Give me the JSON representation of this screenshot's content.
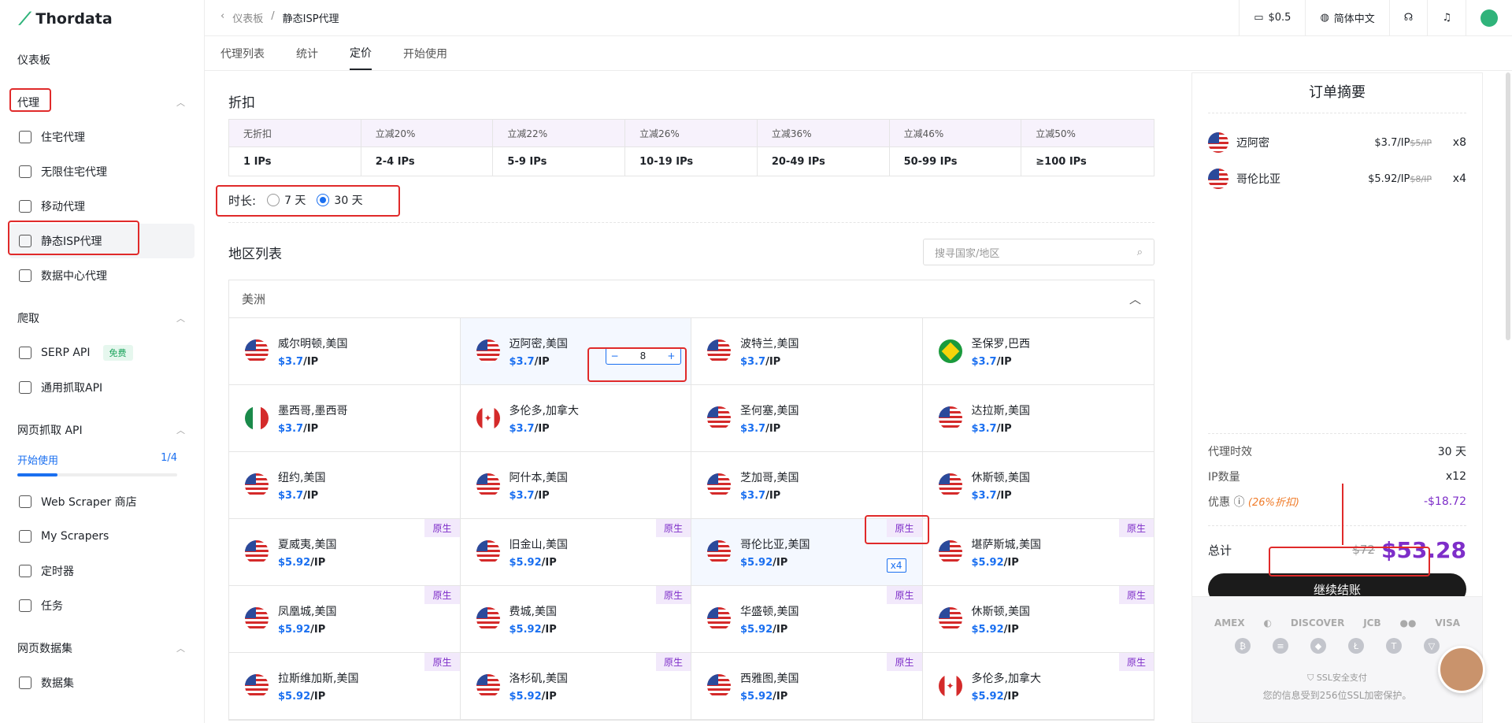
{
  "brand": {
    "name": "Thordata"
  },
  "sidebar": {
    "dashboard": "仪表板",
    "sections": [
      {
        "title": "代理",
        "items": [
          "住宅代理",
          "无限住宅代理",
          "移动代理",
          "静态ISP代理",
          "数据中心代理"
        ]
      },
      {
        "title": "爬取",
        "items": [
          "SERP API",
          "通用抓取API"
        ],
        "free_tag": "免费"
      },
      {
        "title": "网页抓取 API",
        "start": "开始使用",
        "progress_text": "1/4",
        "progress": 0.25,
        "items": [
          "Web Scraper 商店",
          "My Scrapers",
          "定时器",
          "任务"
        ]
      },
      {
        "title": "网页数据集",
        "items": [
          "数据集"
        ]
      }
    ]
  },
  "topbar": {
    "breadcrumb": [
      "仪表板",
      "静态ISP代理"
    ],
    "balance": "$0.5",
    "language": "简体中文"
  },
  "tabs": [
    "代理列表",
    "统计",
    "定价",
    "开始使用"
  ],
  "discount": {
    "title": "折扣",
    "headers": [
      "无折扣",
      "立减20%",
      "立减22%",
      "立减26%",
      "立减36%",
      "立减46%",
      "立减50%"
    ],
    "values": [
      "1 IPs",
      "2-4 IPs",
      "5-9 IPs",
      "10-19 IPs",
      "20-49 IPs",
      "50-99 IPs",
      "≥100 IPs"
    ]
  },
  "duration": {
    "label": "时长:",
    "opt1": "7 天",
    "opt2": "30 天"
  },
  "regions": {
    "title": "地区列表",
    "search_placeholder": "搜寻国家/地区",
    "continent": "美洲",
    "native": "原生",
    "stepper_value": "8",
    "badge": "x4",
    "unit": "/IP",
    "cities": [
      {
        "name": "威尔明顿,美国",
        "price": "$3.7"
      },
      {
        "name": "迈阿密,美国",
        "price": "$3.7"
      },
      {
        "name": "波特兰,美国",
        "price": "$3.7"
      },
      {
        "name": "圣保罗,巴西",
        "price": "$3.7"
      },
      {
        "name": "墨西哥,墨西哥",
        "price": "$3.7"
      },
      {
        "name": "多伦多,加拿大",
        "price": "$3.7"
      },
      {
        "name": "圣何塞,美国",
        "price": "$3.7"
      },
      {
        "name": "达拉斯,美国",
        "price": "$3.7"
      },
      {
        "name": "纽约,美国",
        "price": "$3.7"
      },
      {
        "name": "阿什本,美国",
        "price": "$3.7"
      },
      {
        "name": "芝加哥,美国",
        "price": "$3.7"
      },
      {
        "name": "休斯顿,美国",
        "price": "$3.7"
      },
      {
        "name": "夏威夷,美国",
        "price": "$5.92"
      },
      {
        "name": "旧金山,美国",
        "price": "$5.92"
      },
      {
        "name": "哥伦比亚,美国",
        "price": "$5.92"
      },
      {
        "name": "堪萨斯城,美国",
        "price": "$5.92"
      },
      {
        "name": "凤凰城,美国",
        "price": "$5.92"
      },
      {
        "name": "费城,美国",
        "price": "$5.92"
      },
      {
        "name": "华盛顿,美国",
        "price": "$5.92"
      },
      {
        "name": "休斯顿,美国",
        "price": "$5.92"
      },
      {
        "name": "拉斯维加斯,美国",
        "price": "$5.92"
      },
      {
        "name": "洛杉矶,美国",
        "price": "$5.92"
      },
      {
        "name": "西雅图,美国",
        "price": "$5.92"
      },
      {
        "name": "多伦多,加拿大",
        "price": "$5.92"
      }
    ]
  },
  "order": {
    "title": "订单摘要",
    "items": [
      {
        "name": "迈阿密",
        "price": "$3.7/IP",
        "old": "$5/IP",
        "qty": "x8"
      },
      {
        "name": "哥伦比亚",
        "price": "$5.92/IP",
        "old": "$8/IP",
        "qty": "x4"
      }
    ],
    "duration_label": "代理时效",
    "duration_value": "30 天",
    "ip_label": "IP数量",
    "ip_value": "x12",
    "discount_label": "优惠",
    "discount_note": "(26%折扣)",
    "discount_value": "-$18.72",
    "total_label": "总计",
    "total_old": "$72",
    "total_new": "$53.28",
    "checkout": "继续结账",
    "ssl": "SSL安全支付",
    "ssl_note": "您的信息受到256位SSL加密保护。"
  }
}
